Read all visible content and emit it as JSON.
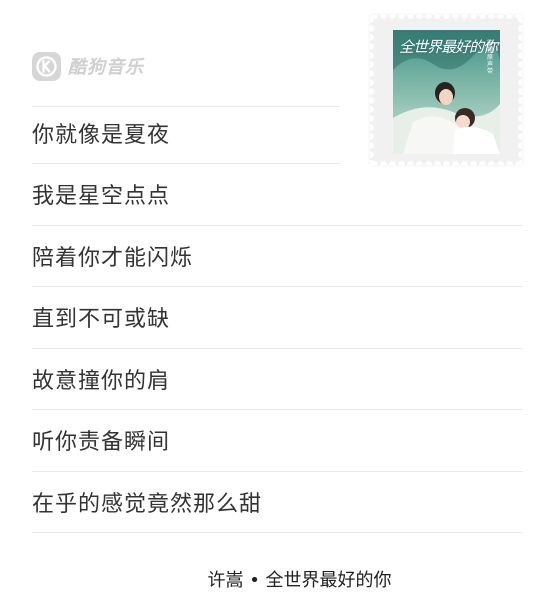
{
  "brand": {
    "name": "酷狗音乐",
    "logo_letter": "K"
  },
  "cover": {
    "title": "全世界最好的你",
    "subtitle": "影视原声带"
  },
  "lyrics": [
    "你就像是夏夜",
    "我是星空点点",
    "陪着你才能闪烁",
    "直到不可或缺",
    "故意撞你的肩",
    "听你责备瞬间",
    "在乎的感觉竟然那么甜"
  ],
  "footer": {
    "caption": "许嵩 • 全世界最好的你"
  },
  "colors": {
    "background": "#ffffff",
    "text": "#333333",
    "divider": "#e9e9e9",
    "brand_gray": "#cfcfcf"
  }
}
